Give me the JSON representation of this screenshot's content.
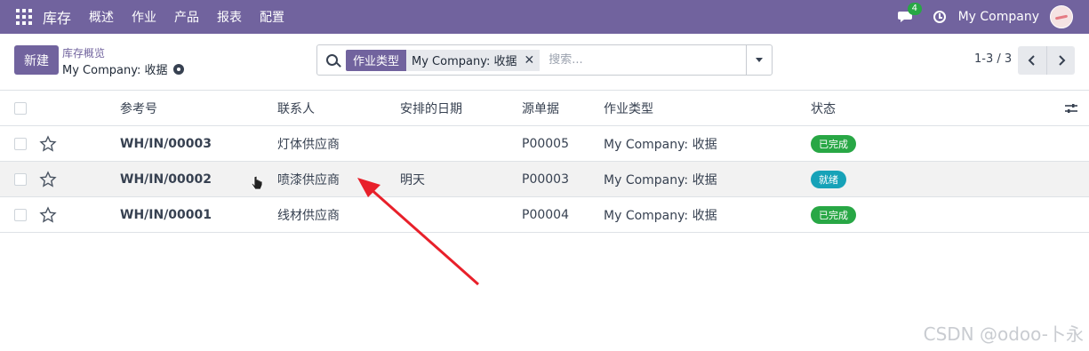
{
  "navbar": {
    "app_name": "库存",
    "menu": [
      "概述",
      "作业",
      "产品",
      "报表",
      "配置"
    ],
    "chat_count": "4",
    "company": "My Company",
    "bg_color": "#71639e"
  },
  "control": {
    "new_label": "新建",
    "breadcrumb_parent": "库存概览",
    "breadcrumb_current": "My Company: 收据",
    "search": {
      "facet_label": "作业类型",
      "facet_value": "My Company: 收据",
      "placeholder": "搜索..."
    },
    "pager": "1-3 / 3"
  },
  "table": {
    "columns": [
      "参考号",
      "联系人",
      "安排的日期",
      "源单据",
      "作业类型",
      "状态"
    ],
    "rows": [
      {
        "ref": "WH/IN/00003",
        "contact": "灯体供应商",
        "date": "",
        "source": "P00005",
        "type": "My Company: 收据",
        "status": "已完成"
      },
      {
        "ref": "WH/IN/00002",
        "contact": "喷漆供应商",
        "date": "明天",
        "source": "P00003",
        "type": "My Company: 收据",
        "status": "就绪"
      },
      {
        "ref": "WH/IN/00001",
        "contact": "线材供应商",
        "date": "",
        "source": "P00004",
        "type": "My Company: 收据",
        "status": "已完成"
      }
    ]
  },
  "watermark": "CSDN @odoo-卜永",
  "colors": {
    "done": "#28a745",
    "ready": "#17a2b8",
    "annotation_arrow": "#e8202a"
  }
}
